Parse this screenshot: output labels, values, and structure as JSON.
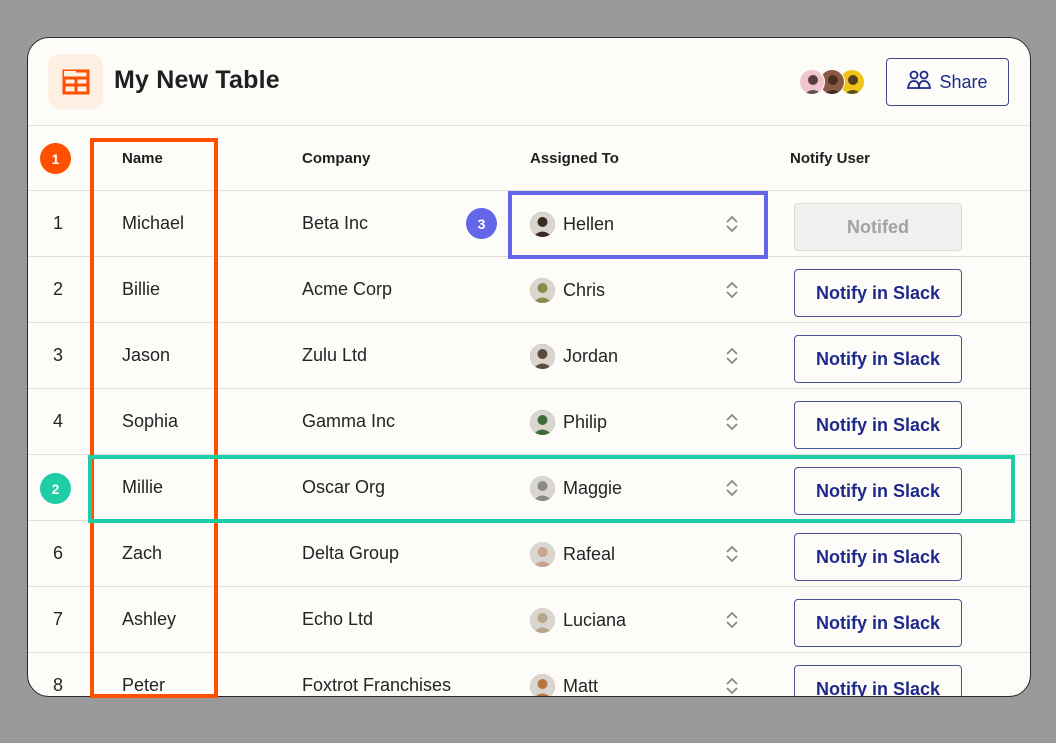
{
  "header": {
    "title": "My New Table",
    "app_icon": "table-icon",
    "share_label": "Share",
    "share_icon": "users-icon",
    "collaborators": [
      {
        "name": "collaborator-1",
        "bg": "#f2c4cf"
      },
      {
        "name": "collaborator-2",
        "bg": "#8a5a44"
      },
      {
        "name": "collaborator-3",
        "bg": "#f0c419"
      }
    ]
  },
  "table": {
    "columns": {
      "row_number": "",
      "name": "Name",
      "company": "Company",
      "assigned_to": "Assigned To",
      "notify_user": "Notify User"
    },
    "rows": [
      {
        "num": "1",
        "name": "Michael",
        "company": "Beta Inc",
        "assignee": "Hellen",
        "avatar_bg": "#3a2a22",
        "notify": "Notifed",
        "notified": true
      },
      {
        "num": "2",
        "name": "Billie",
        "company": "Acme Corp",
        "assignee": "Chris",
        "avatar_bg": "#8b8a4a",
        "notify": "Notify in Slack",
        "notified": false
      },
      {
        "num": "3",
        "name": "Jason",
        "company": "Zulu Ltd",
        "assignee": "Jordan",
        "avatar_bg": "#5a4a40",
        "notify": "Notify in Slack",
        "notified": false
      },
      {
        "num": "4",
        "name": "Sophia",
        "company": "Gamma Inc",
        "assignee": "Philip",
        "avatar_bg": "#3d6b3a",
        "notify": "Notify in Slack",
        "notified": false
      },
      {
        "num": "",
        "name": "Millie",
        "company": "Oscar Org",
        "assignee": "Maggie",
        "avatar_bg": "#8a8a8a",
        "notify": "Notify in Slack",
        "notified": false
      },
      {
        "num": "6",
        "name": "Zach",
        "company": "Delta Group",
        "assignee": "Rafeal",
        "avatar_bg": "#c9a48e",
        "notify": "Notify in Slack",
        "notified": false
      },
      {
        "num": "7",
        "name": "Ashley",
        "company": "Echo Ltd",
        "assignee": "Luciana",
        "avatar_bg": "#b7a58a",
        "notify": "Notify in Slack",
        "notified": false
      },
      {
        "num": "8",
        "name": "Peter",
        "company": "Foxtrot Franchises",
        "assignee": "Matt",
        "avatar_bg": "#b7763f",
        "notify": "Notify in Slack",
        "notified": false
      }
    ]
  },
  "annotations": {
    "marker_1": {
      "label": "1",
      "color": "#ff4f00"
    },
    "marker_2": {
      "label": "2",
      "color": "#1ecca6"
    },
    "marker_3": {
      "label": "3",
      "color": "#6366e8"
    }
  },
  "colors": {
    "accent_orange": "#ff4f00",
    "accent_teal": "#1ecca6",
    "accent_indigo": "#6366e8",
    "button_text": "#1e2a8a"
  }
}
